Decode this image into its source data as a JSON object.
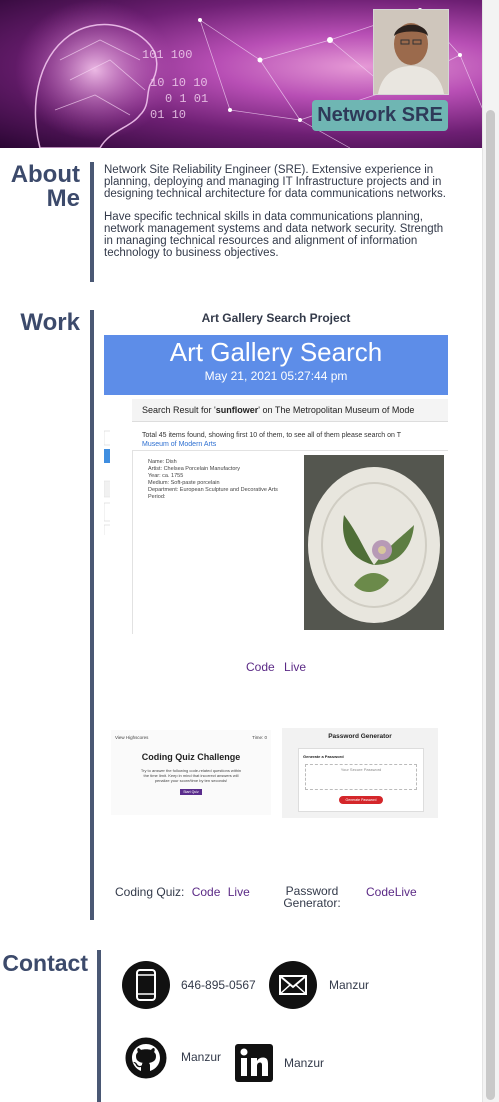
{
  "header": {
    "brand": "Network SRE",
    "binary_digits": [
      "101 100",
      "10 10 10",
      "0 1 01",
      "01 10"
    ]
  },
  "about": {
    "title_line1": "About",
    "title_line2": "Me",
    "paragraph1": "Network Site Reliability Engineer (SRE). Extensive experience in planning, deploying and managing IT Infrastructure projects and in designing technical architecture for data communications networks.",
    "paragraph2": "Have specific technical skills in data communications planning, network management systems and data network security. Strength in managing technical resources and alignment of information technology to business objectives."
  },
  "work": {
    "title": "Work",
    "featured": {
      "title": "Art Gallery Search Project",
      "screenshot": {
        "app_title": "Art Gallery Search",
        "date": "May 21, 2021 05:27:44 pm",
        "search_result_prefix": "Search Result for '",
        "search_term": "sunflower",
        "search_result_suffix": "' on The Metropolitan Museum of Mode",
        "found_text": "Total 45 items found, showing first 10 of them, to see all of them please search on T",
        "found_link": "Museum of Modern Arts",
        "meta": [
          "Name: Dish",
          "Artist: Chelsea Porcelain Manufactory",
          "Year: ca. 1755",
          "Medium: Soft-paste porcelain",
          "Department: European Sculpture and Decorative Arts",
          "Period:"
        ]
      },
      "code_label": "Code",
      "live_label": "Live"
    },
    "quiz": {
      "screenshot": {
        "view_highscores": "View Highscores",
        "time": "Time: 0",
        "title": "Coding Quiz Challenge",
        "description": "Try to answer the following code-related questions within the time limit. Keep in mind that incorrect answers will penalize your score/time by ten seconds!",
        "start": "Start Quiz"
      },
      "label": "Coding Quiz:",
      "code_label": "Code",
      "live_label": "Live"
    },
    "password": {
      "screenshot": {
        "title": "Password Generator",
        "subtitle": "Generate a Password",
        "placeholder": "Your Secure Password",
        "button": "Generate Password"
      },
      "label_line1": "Password",
      "label_line2": "Generator:",
      "code_label": "Code",
      "live_label": "Live"
    }
  },
  "contact": {
    "title": "Contact",
    "phone": "646-895-0567",
    "email_label": "Manzur",
    "github_label": "Manzur",
    "linkedin_label": "Manzur"
  },
  "colors": {
    "accent_bar": "#4a5874",
    "brand_badge": "#6fb6b3",
    "link": "#5b2a86",
    "banner_blue": "#5d8de8"
  }
}
